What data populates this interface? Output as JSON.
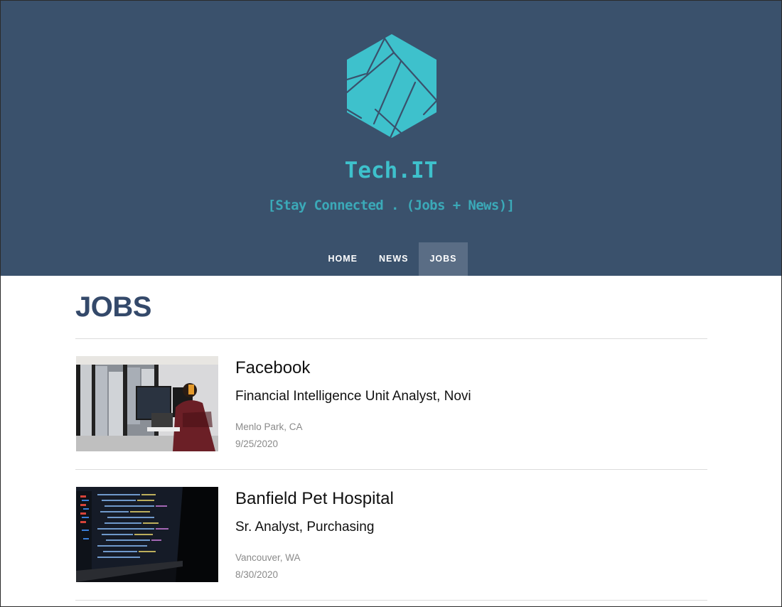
{
  "colors": {
    "header_bg": "#3a516c",
    "brand_teal": "#3ec1cc",
    "nav_active_bg": "#5a6d85",
    "heading": "#34496a"
  },
  "brand": {
    "logo_icon": "hexagon-logo-icon",
    "title": "Tech.IT",
    "tagline": "[Stay Connected . (Jobs + News)]"
  },
  "nav": {
    "items": [
      {
        "label": "HOME",
        "active": false
      },
      {
        "label": "NEWS",
        "active": false
      },
      {
        "label": "JOBS",
        "active": true
      }
    ]
  },
  "main": {
    "heading": "JOBS",
    "jobs": [
      {
        "company": "Facebook",
        "title": "Financial Intelligence Unit Analyst, Novi",
        "location": "Menlo Park, CA",
        "date": "9/25/2020",
        "image": "office-woman-at-computer-photo"
      },
      {
        "company": "Banfield Pet Hospital",
        "title": "Sr. Analyst, Purchasing",
        "location": "Vancouver, WA",
        "date": "8/30/2020",
        "image": "code-on-laptop-screen-photo"
      }
    ]
  }
}
